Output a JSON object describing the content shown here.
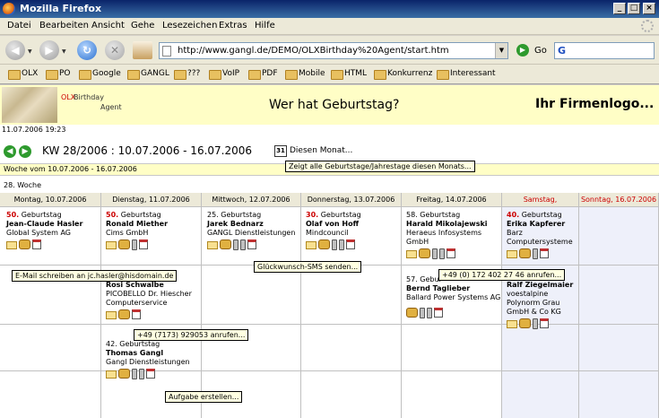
{
  "window": {
    "title": "Mozilla Firefox"
  },
  "menu": [
    "Datei",
    "Bearbeiten",
    "Ansicht",
    "Gehe",
    "Lesezeichen",
    "Extras",
    "Hilfe"
  ],
  "toolbar": {
    "url": "http://www.gangl.de/DEMO/OLXBirthday%20Agent/start.htm",
    "go_label": "Go"
  },
  "bookmarks": [
    "OLX",
    "PO",
    "Google",
    "GANGL",
    "???",
    "VoIP",
    "PDF",
    "Mobile",
    "HTML",
    "Konkurrenz",
    "Interessant"
  ],
  "page": {
    "logo_olx": "OLX",
    "logo_birthday": "Birthday",
    "logo_agent": "Agent",
    "title": "Wer hat Geburtstag?",
    "company_logo": "Ihr Firmenlogo...",
    "datetime": "11.07.2006 19:23",
    "kw_label": "KW 28/2006 :  10.07.2006 - 16.07.2006",
    "month_link": "Diesen Monat...",
    "cal_icon_text": "31",
    "week_bar": "Woche vom 10.07.2006 - 16.07.2006",
    "week_label": "28. Woche"
  },
  "days": [
    "Montag, 10.07.2006",
    "Dienstag, 11.07.2006",
    "Mittwoch, 12.07.2006",
    "Donnerstag, 13.07.2006",
    "Freitag, 14.07.2006",
    "Samstag, 15.07.2006",
    "Sonntag, 16.07.2006"
  ],
  "entries": {
    "e1": {
      "num": "50.",
      "suffix": " Geburtstag",
      "name": "Jean-Claude Hasler",
      "comp1": "Global System AG",
      "comp2": "",
      "comp3": ""
    },
    "e2": {
      "num": "50.",
      "suffix": " Geburtstag",
      "name": "Ronald Miether",
      "comp1": "Cims GmbH",
      "comp2": "",
      "comp3": ""
    },
    "e3": {
      "num": "",
      "suffix": "Rosi Schwalbe",
      "name": "",
      "comp1": "PICOBELLO Dr. Hiescher",
      "comp2": "Computerservice",
      "comp3": ""
    },
    "e4": {
      "num": "",
      "suffix": "42. Geburtstag",
      "name": "Thomas Gangl",
      "comp1": "Gangl Dienstleistungen",
      "comp2": "",
      "comp3": ""
    },
    "e5": {
      "num": "",
      "suffix": "25. Geburtstag",
      "name": "Jarek Bednarz",
      "comp1": "GANGL Dienstleistungen",
      "comp2": "",
      "comp3": ""
    },
    "e6": {
      "num": "30.",
      "suffix": " Geburtstag",
      "name": "Olaf von Hoff",
      "comp1": "Mindcouncil",
      "comp2": "",
      "comp3": ""
    },
    "e7": {
      "num": "",
      "suffix": "58. Geburtstag",
      "name": "Harald Mikolajewski",
      "comp1": "Heraeus Infosystems",
      "comp2": "GmbH",
      "comp3": ""
    },
    "e8": {
      "num": "",
      "suffix": "57. Gebur",
      "name": "Bernd Taglieber",
      "comp1": "Ballard Power Systems AG",
      "comp2": "",
      "comp3": ""
    },
    "e9": {
      "num": "40.",
      "suffix": " Geburtstag",
      "name": "Erika Kapferer",
      "comp1": "Barz",
      "comp2": "Computersysteme",
      "comp3": ""
    },
    "e10": {
      "num": "",
      "suffix": "Ralf Ziegelmaier",
      "name": "",
      "comp1": "voestalpine",
      "comp2": "Polynorm Grau",
      "comp3": "GmbH & Co KG"
    }
  },
  "tooltips": {
    "month": "Zeigt alle Geburtstage/Jahrestage diesen Monats...",
    "email": "E-Mail schreiben an jc.hasler@hisdomain.de",
    "sms": "Glückwunsch-SMS senden...",
    "call1": "+49 (0) 172 402 27 46 anrufen...",
    "call2": "+49 (7173) 929053 anrufen...",
    "task": "Aufgabe erstellen..."
  },
  "icons": [
    "mail-icon",
    "phone-icon",
    "cell-icon",
    "task-icon"
  ],
  "colors": {
    "sunday_red": "#cc0000",
    "header_bg": "#fffec6",
    "age_red": "#cc0000"
  }
}
